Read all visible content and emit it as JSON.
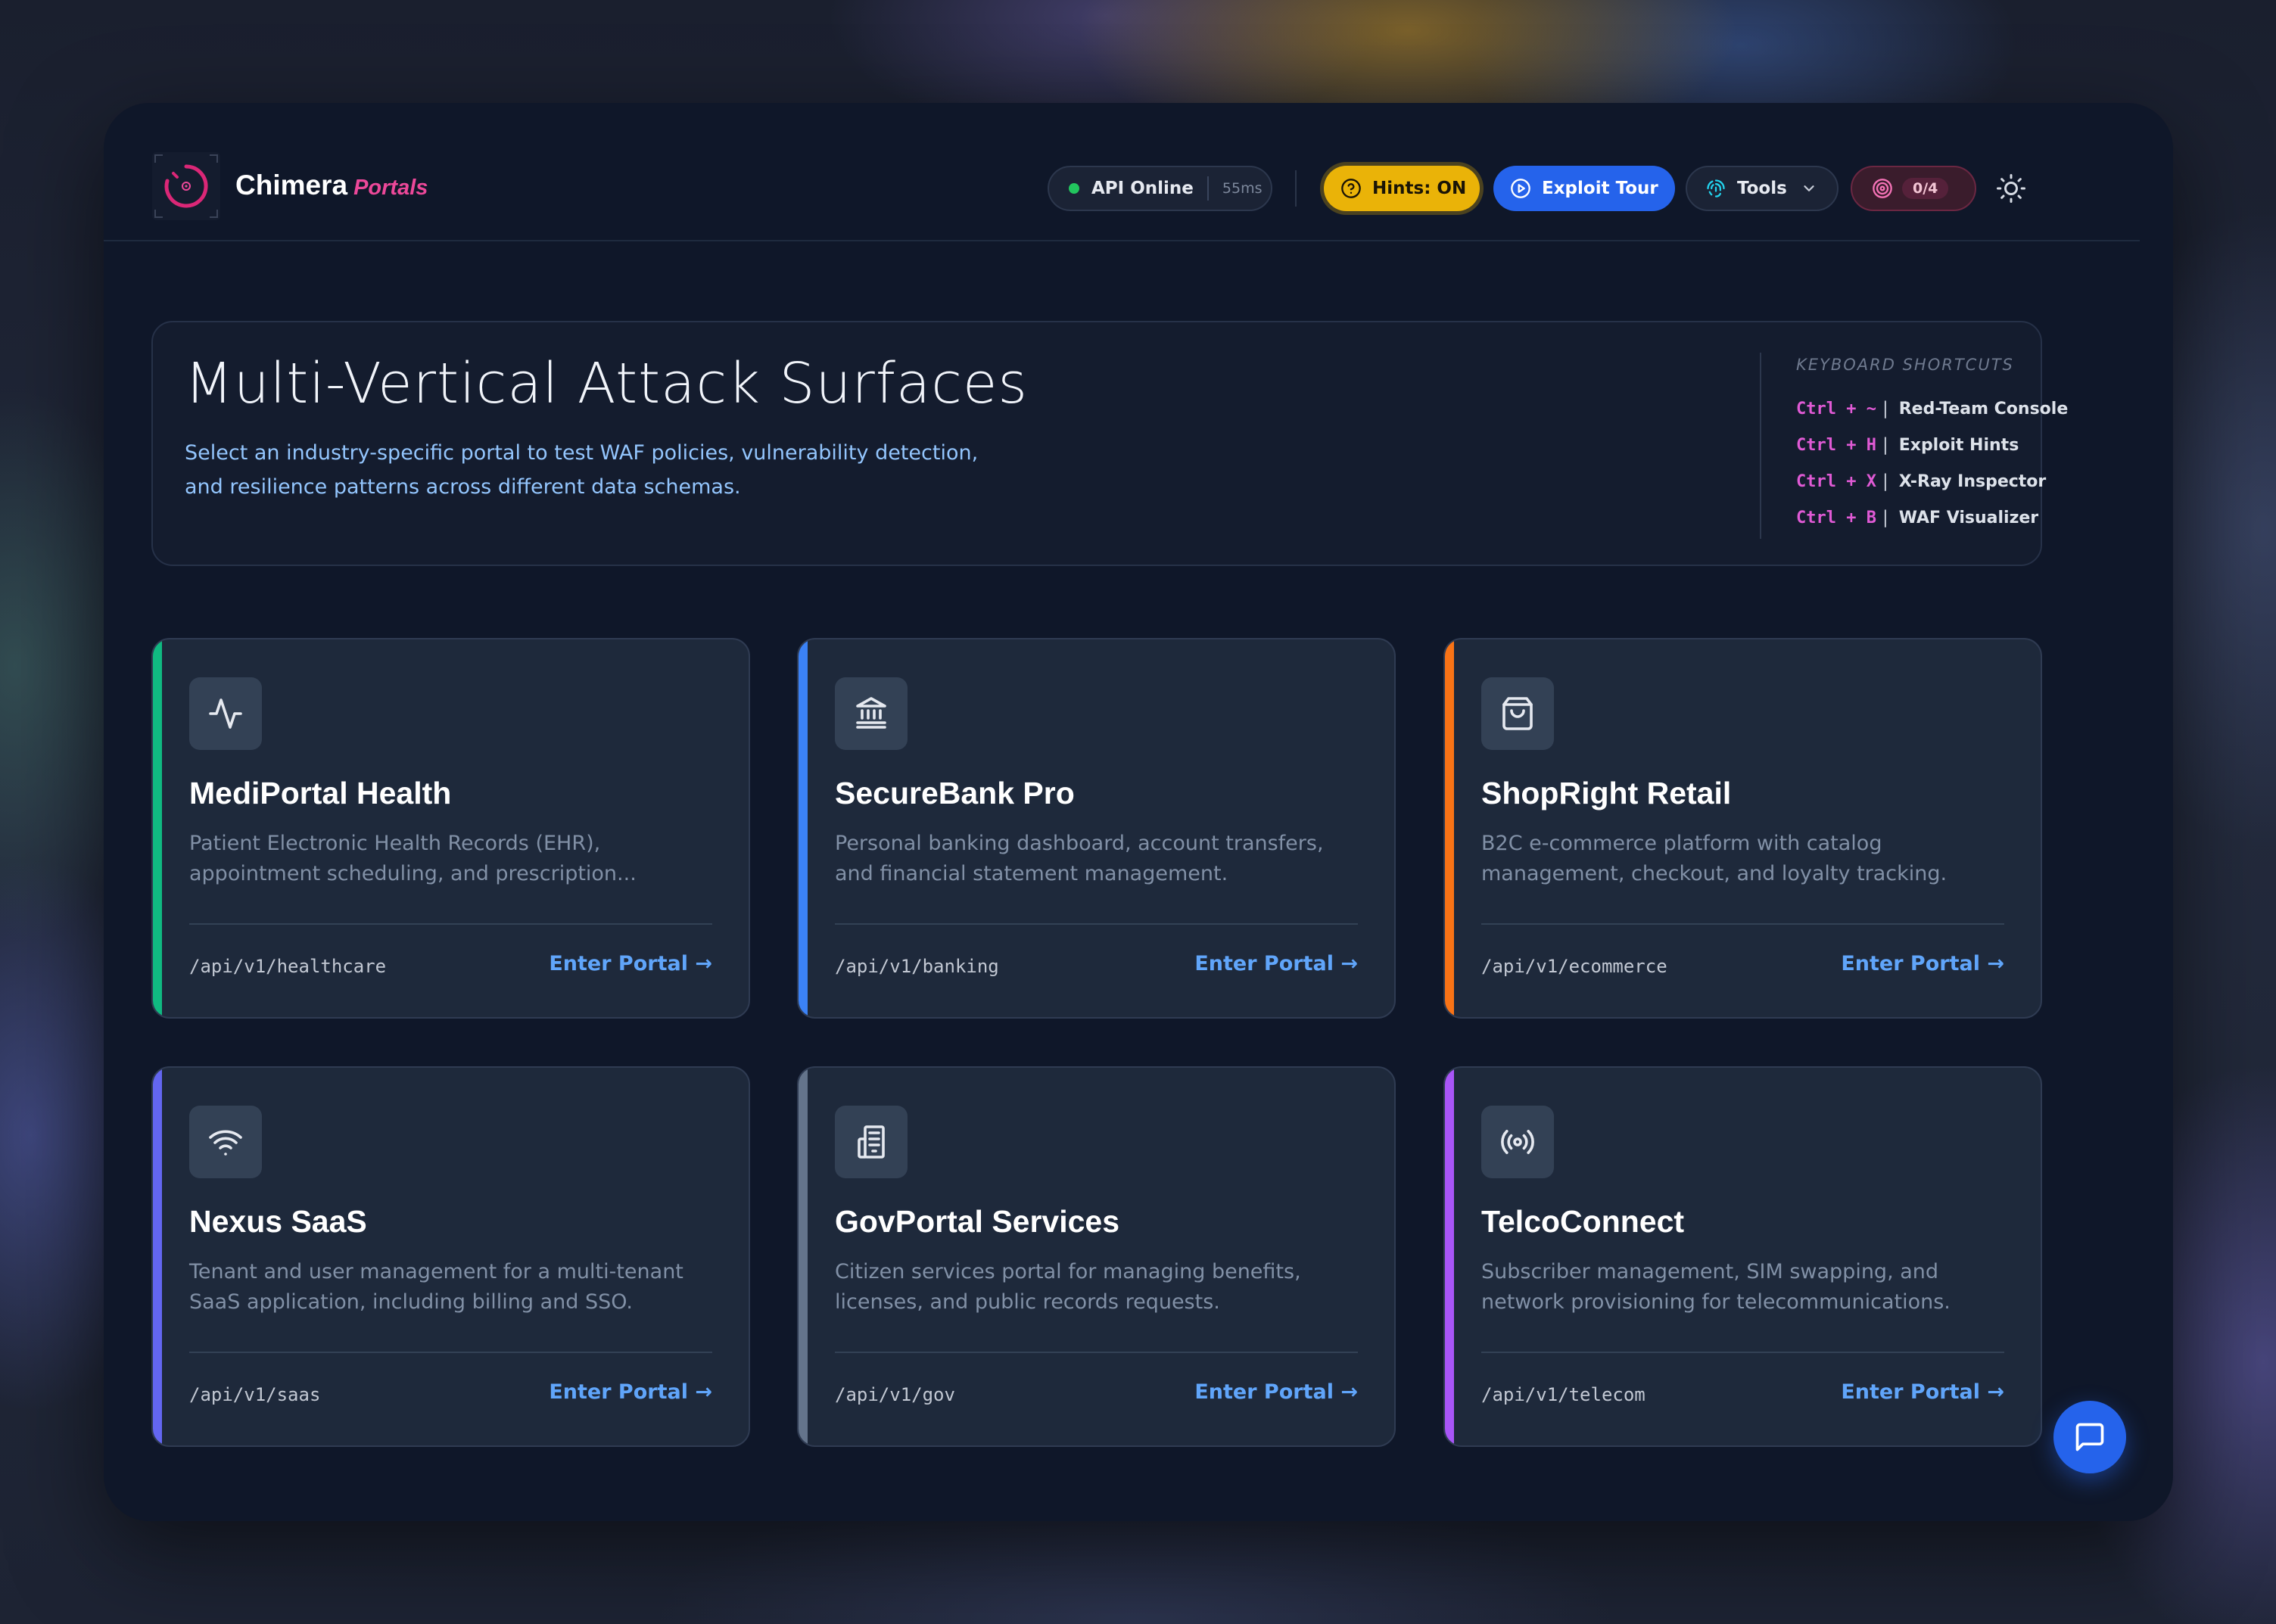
{
  "header": {
    "brand": "Chimera",
    "brand_sub": "Portals",
    "api_status": "API Online",
    "api_latency": "55ms",
    "hints_label": "Hints: ON",
    "tour_label": "Exploit Tour",
    "tools_label": "Tools",
    "score": "0/4"
  },
  "hero": {
    "title": "Multi-Vertical Attack Surfaces",
    "description": "Select an industry-specific portal to test WAF policies, vulnerability detection, and resilience patterns across different data schemas.",
    "shortcuts_title": "KEYBOARD SHORTCUTS",
    "shortcuts": [
      {
        "key": "Ctrl + ~",
        "label": "Red-Team Console"
      },
      {
        "key": "Ctrl + H",
        "label": "Exploit Hints"
      },
      {
        "key": "Ctrl + X",
        "label": "X-Ray Inspector"
      },
      {
        "key": "Ctrl + B",
        "label": "WAF Visualizer"
      }
    ]
  },
  "portals": [
    {
      "title": "MediPortal Health",
      "description": "Patient Electronic Health Records (EHR), appointment scheduling, and prescription...",
      "path": "/api/v1/healthcare",
      "link": "Enter Portal →",
      "accent": "#10b981",
      "icon": "activity-icon"
    },
    {
      "title": "SecureBank Pro",
      "description": "Personal banking dashboard, account transfers, and financial statement management.",
      "path": "/api/v1/banking",
      "link": "Enter Portal →",
      "accent": "#3b82f6",
      "icon": "bank-icon"
    },
    {
      "title": "ShopRight Retail",
      "description": "B2C e-commerce platform with catalog management, checkout, and loyalty tracking.",
      "path": "/api/v1/ecommerce",
      "link": "Enter Portal →",
      "accent": "#f97316",
      "icon": "shopping-bag-icon"
    },
    {
      "title": "Nexus SaaS",
      "description": "Tenant and user management for a multi-tenant SaaS application, including billing and SSO.",
      "path": "/api/v1/saas",
      "link": "Enter Portal →",
      "accent": "#6366f1",
      "icon": "wifi-icon"
    },
    {
      "title": "GovPortal Services",
      "description": "Citizen services portal for managing benefits, licenses, and public records requests.",
      "path": "/api/v1/gov",
      "link": "Enter Portal →",
      "accent": "#64748b",
      "icon": "building-icon"
    },
    {
      "title": "TelcoConnect",
      "description": "Subscriber management, SIM swapping, and network provisioning for telecommunications.",
      "path": "/api/v1/telecom",
      "link": "Enter Portal →",
      "accent": "#a855f7",
      "icon": "broadcast-icon"
    }
  ],
  "colors": {
    "hints": "#eab308",
    "tour": "#2563eb",
    "brand_accent": "#ec4899",
    "shortcut_key": "#e05ad5"
  }
}
